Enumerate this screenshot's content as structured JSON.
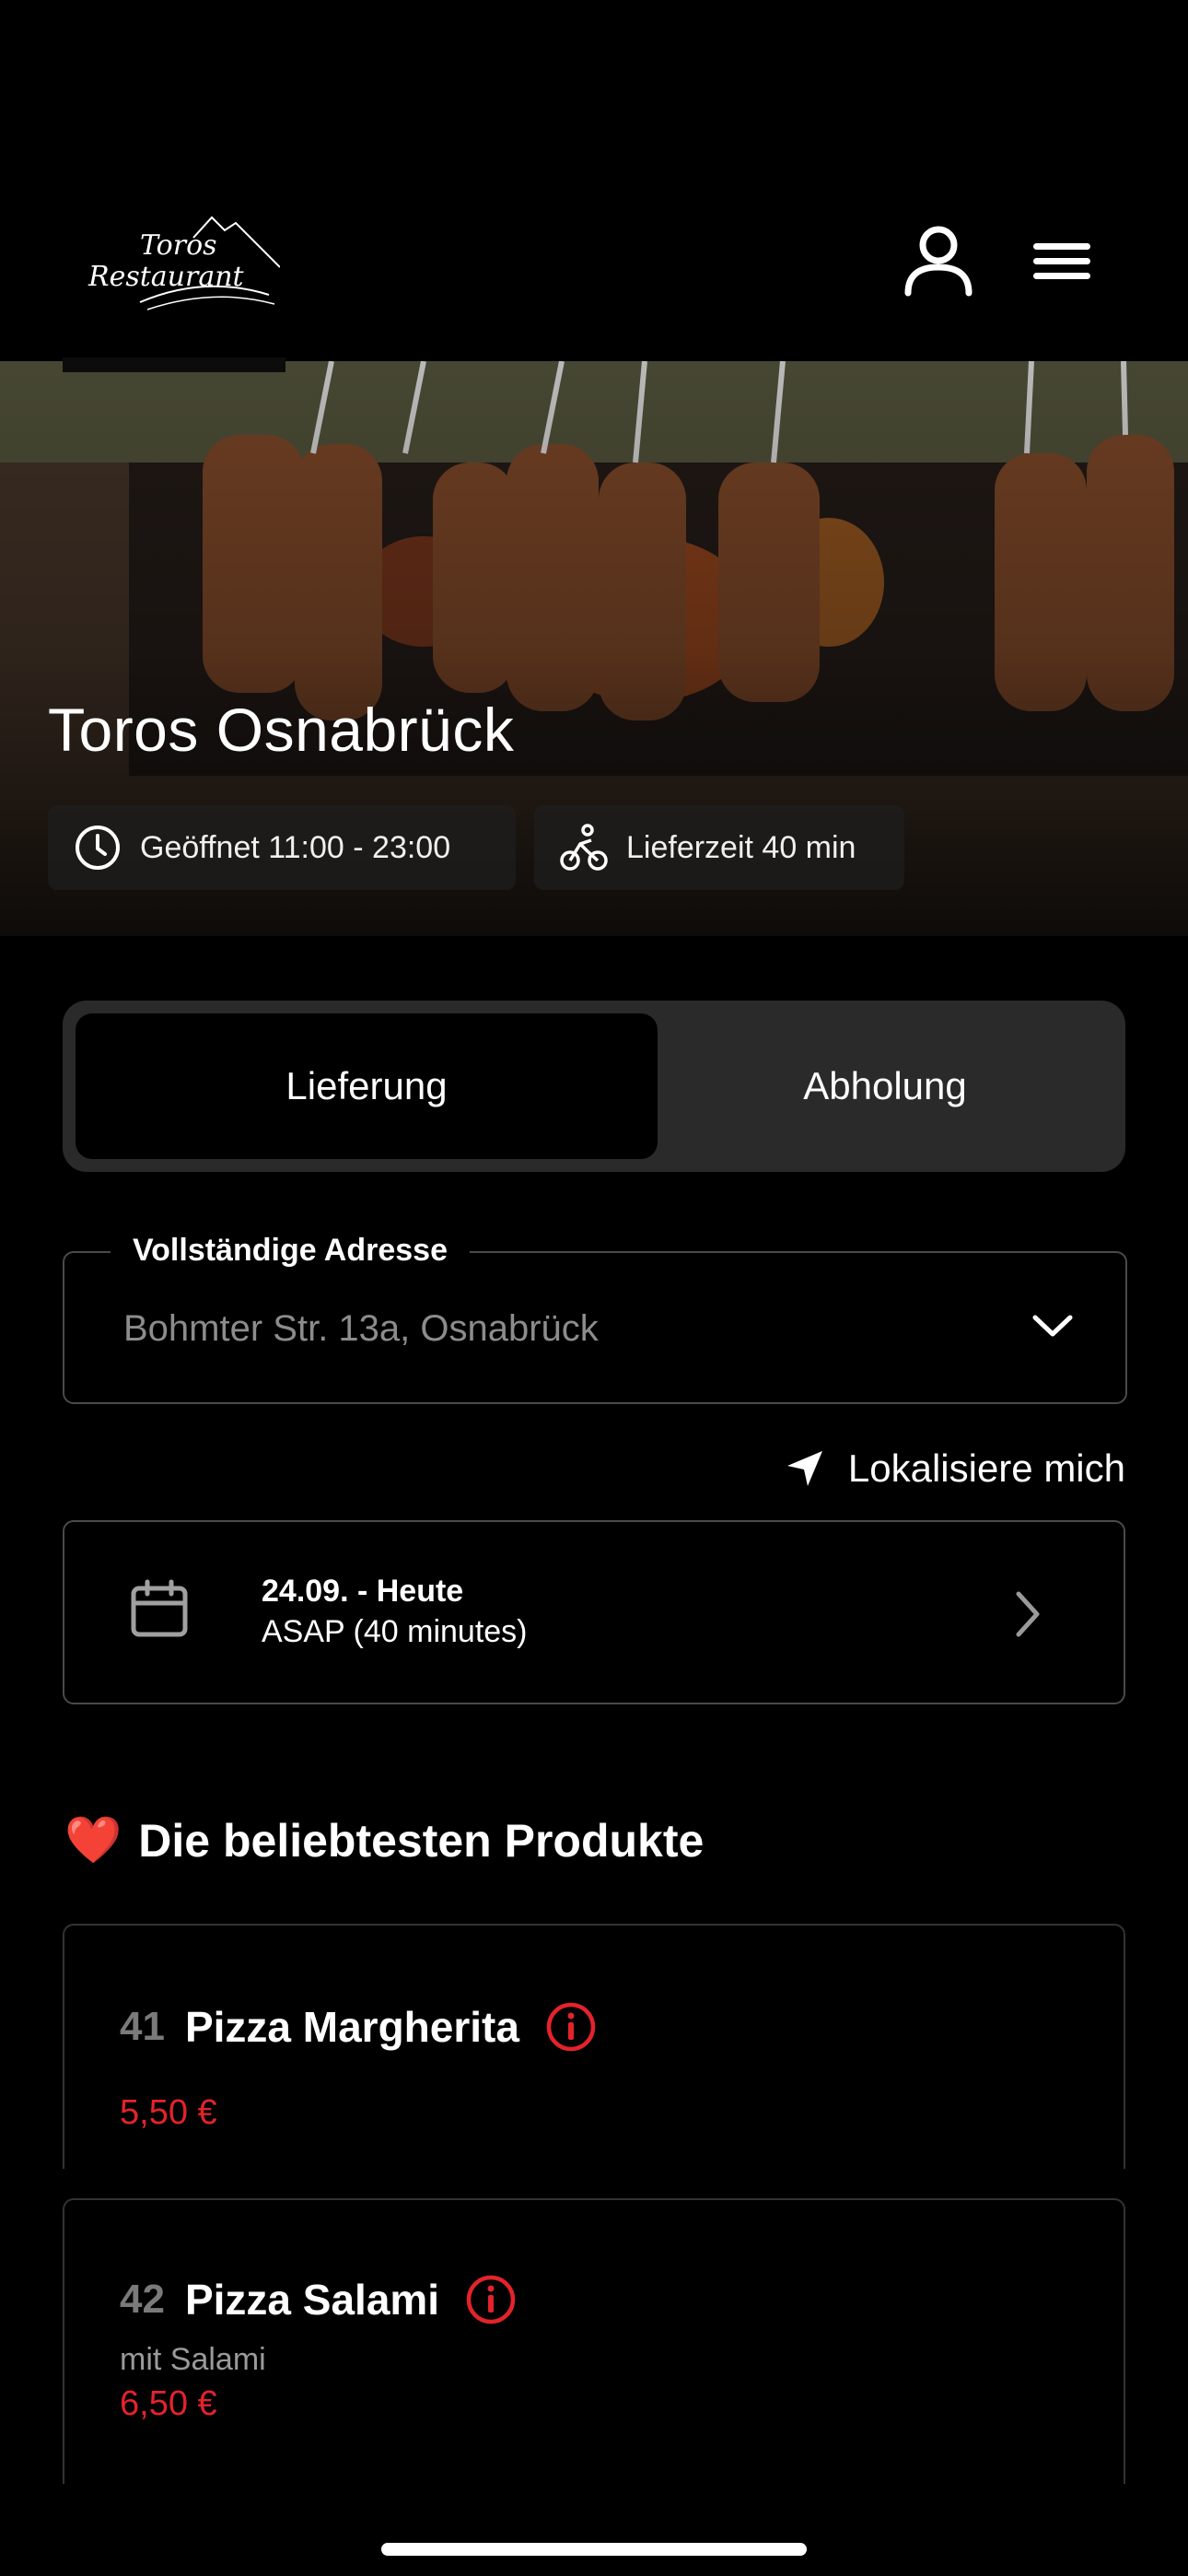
{
  "header": {
    "logo_text_line1": "Toros",
    "logo_text_line2": "Restaurant"
  },
  "hero": {
    "title": "Toros Osnabrück",
    "open_label": "Geöffnet 11:00 - 23:00",
    "delivery_time_label": "Lieferzeit 40 min"
  },
  "order_mode": {
    "options": [
      "Lieferung",
      "Abholung"
    ],
    "selected": "Lieferung"
  },
  "address": {
    "label": "Vollständige Adresse",
    "placeholder": "Bohmter Str. 13a, Osnabrück"
  },
  "locate_label": "Lokalisiere mich",
  "schedule": {
    "date": "24.09. - Heute",
    "time": "ASAP (40 minutes)"
  },
  "popular": {
    "title": "Die beliebtesten Produkte",
    "emoji": "❤️",
    "products": [
      {
        "number": "41",
        "name": "Pizza Margherita",
        "description": "",
        "price": "5,50 €"
      },
      {
        "number": "42",
        "name": "Pizza Salami",
        "description": "mit Salami",
        "price": "6,50 €"
      }
    ]
  },
  "colors": {
    "background": "#000000",
    "accent_price": "#e3232a",
    "toggle_bg": "#2a2a2a"
  }
}
